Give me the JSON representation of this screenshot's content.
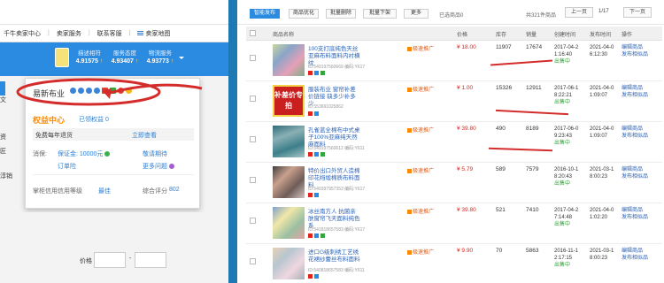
{
  "left": {
    "nav": [
      "千牛卖家中心",
      "卖家服务",
      "联系客服",
      "卖家地图"
    ],
    "scores": [
      {
        "label": "描述相符",
        "value": "4.91575"
      },
      {
        "label": "服务态度",
        "value": "4.93407"
      },
      {
        "label": "物流服务",
        "value": "4.93773"
      }
    ],
    "popup": {
      "shop_name": "易新布业",
      "rights_title": "权益中心",
      "rights_sub": "已领权益 0",
      "free_return": "免费每年退货",
      "view_now": "立即查看",
      "deposit_label": "消保:",
      "deposit_value": "保证金: 10000元",
      "deposit_link": "敬请期待",
      "order_insurance": "订单险",
      "more_questions": "更多问题",
      "credit_label": "掌柜信用:",
      "credit_level_label": "信用等级",
      "credit_level_value": "最佳",
      "overall_label": "综合评分",
      "overall_value": "802"
    },
    "side_marks": [
      "文",
      "资",
      "匠",
      "淳销"
    ],
    "price_label": "价格",
    "price_dash": "-"
  },
  "right": {
    "toolbar": {
      "buttons": [
        "智能发布",
        "商品优化",
        "批量删除",
        "批量下架",
        "更多"
      ],
      "selected": "已选商品0",
      "total": "共321件商品",
      "prev": "上一页",
      "page": "1/17",
      "next": "下一页"
    },
    "columns": [
      "商品名称",
      "价格",
      "库存",
      "销量",
      "创建时间",
      "发布时间",
      "操作"
    ],
    "rows": [
      {
        "title": "100支打底纯色天丝亚麻布料面料内衬横纹",
        "id": "ID:549197560669 编码:Y617",
        "promo": "极速推广",
        "price": "¥ 18.00",
        "stock": "11907",
        "sales": "17674",
        "created": "2017-04-2 1:16:40",
        "status": "出售中",
        "published": "2021-04-0 6:12:30",
        "ops": [
          "编辑商品",
          "发布相似品"
        ]
      },
      {
        "title": "服装布业 窗帘补差价链接 缺多少补多少",
        "id": "ID:553691025862",
        "promo": "极速推广",
        "price": "¥ 1.00",
        "stock": "15326",
        "sales": "12911",
        "created": "2017-06-1 8:22:21",
        "status": "出售中",
        "published": "2021-04-0 1:09:07",
        "ops": [
          "编辑商品",
          "发布相似品"
        ]
      },
      {
        "title": "孔雀蓝全棉布中式桌子100%亚麻纯天然麻面料",
        "id": "ID:549197560612 编码:Y611",
        "promo": "极速推广",
        "price": "¥ 39.80",
        "stock": "490",
        "sales": "8189",
        "created": "2017-06-0 9:23:43",
        "status": "出售中",
        "published": "2021-04-0 1:09:07",
        "ops": [
          "编辑商品",
          "发布相似品"
        ]
      },
      {
        "title": "特价出口外贸人造棉印花绉缎棉质布料面料",
        "id": "ID:540397957353 编码:Y617",
        "promo": "极速推广",
        "price": "¥ 5.79",
        "stock": "589",
        "sales": "7579",
        "created": "2016-10-1 8:20:43",
        "status": "出售中",
        "published": "2021-03-1 8:00:23",
        "ops": [
          "编辑商品",
          "发布相似品"
        ]
      },
      {
        "title": "冰丝南方人 抗菌亲肤窗帘飞天面料纯色系",
        "id": "ID:541818657583 编码:Y617",
        "promo": "极速推广",
        "price": "¥ 39.80",
        "stock": "521",
        "sales": "7410",
        "created": "2017-04-2 7:14:48",
        "status": "出售中",
        "published": "2021-04-0 1:02:20",
        "ops": [
          "编辑商品",
          "发布相似品"
        ]
      },
      {
        "title": "进口G级刺绣工艺绣花裙纱蕾丝布料面料",
        "id": "ID:540818657583 编码:Y611",
        "promo": "极速推广",
        "price": "¥ 9.90",
        "stock": "70",
        "sales": "5863",
        "created": "2016-11-1 2:17:15",
        "status": "出售中",
        "published": "2021-03-1 8:00:23",
        "ops": [
          "编辑商品",
          "发布相似品"
        ]
      }
    ],
    "promo_label": "补差价专拍"
  },
  "colors": {
    "accent": "#2b8be0",
    "price_red": "#e2231a",
    "annotation_red": "#d42b2b",
    "orange": "#ff8a00",
    "page_bg": "#1e78b4"
  }
}
